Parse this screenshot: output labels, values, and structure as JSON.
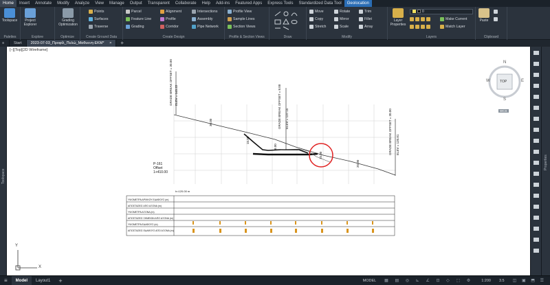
{
  "menu_tabs": [
    "Home",
    "Insert",
    "Annotate",
    "Modify",
    "Analyze",
    "View",
    "Manage",
    "Output",
    "Transparent",
    "Collaborate",
    "Help",
    "Add-ins",
    "Featured Apps",
    "Express Tools",
    "Standardized Data Tool",
    "Geolocation"
  ],
  "ribbon": {
    "toolspace": "Toolspace",
    "project_explorer": "Project Explorer",
    "grading_optimization": "Grading Optimization",
    "palettes": "Palettes",
    "explore": "Explore",
    "optimize": "Optimize",
    "ground_data": {
      "points": "Points",
      "surfaces": "Surfaces",
      "traverse": "Traverse",
      "title": "Create Ground Data"
    },
    "design": {
      "parcel": "Parcel",
      "feature_line": "Feature Line",
      "grading": "Grading",
      "alignment": "Alignment",
      "profile": "Profile",
      "corridor": "Corridor",
      "intersections": "Intersections",
      "assembly": "Assembly",
      "pipe_network": "Pipe Network",
      "title": "Create Design"
    },
    "profile_section": {
      "profile_view": "Profile View",
      "sample_lines": "Sample Lines",
      "section_views": "Section Views",
      "title": "Profile & Section Views"
    },
    "draw_title": "Draw",
    "modify": {
      "move": "Move",
      "copy": "Copy",
      "stretch": "Stretch",
      "rotate": "Rotate",
      "mirror": "Mirror",
      "scale": "Scale",
      "trim": "Trim",
      "fillet": "Fillet",
      "array": "Array",
      "title": "Modify"
    },
    "layers": {
      "layer_properties": "Layer Properties",
      "layer_value": "0",
      "make_current": "Make Current",
      "match_layer": "Match Layer",
      "title": "Layers"
    },
    "clipboard": {
      "paste": "Paste",
      "title": "Clipboard"
    }
  },
  "doc_tabs": {
    "start": "Start",
    "drawing": "2023-07-03_Προφίλ_Πυλώ_Μαθυενη-ΕΚΜ*"
  },
  "viewport_label": "[−][Top][2D Wireframe]",
  "side_labels": {
    "left": "Toolspace",
    "right": "Properties"
  },
  "viewcube": {
    "n": "N",
    "s": "S",
    "w": "W",
    "e": "E",
    "top": "TOP",
    "wcs": "WCS"
  },
  "drawing": {
    "left_label_1": "GRADE BREAK OFFSET = 30.00",
    "left_label_2": "ELEV = 145.22",
    "mid_label_1": "GRADE BREAK OFFSET = 8.00",
    "mid_label_2": "ELEV = 137.15",
    "right_label_1": "GRADE BREAK OFFSET = 30.00",
    "right_label_2": "ELEV = 120.81",
    "slope_1": "30.00",
    "slope_2": "15.00",
    "slope_3": "8.00",
    "slope_4": "10.00",
    "slope_5": "20.00",
    "station_1": "P-161",
    "station_2": "Offset",
    "station_3": "1+410.00",
    "datum": "h=120.00 m",
    "table_rows": [
      "ΥΨΟΜΕΤΡΑ ΑΡΧΙΚΟΥ ΕΔΑΦΟΥΣ (m)",
      "ΑΠΟΣΤΑΣΕΙΣ ΑΠΟ ΑΞΟΝΑ (m)",
      "ΥΨΟΜΕΤΡΑ ΑΞΟΝΑ (m)",
      "ΑΠΟΣΤΑΣΕΙΣ ΣΗΜΕΙΩΝ ΑΠΟ ΑΞΟΝΑ (m)",
      "ΥΨΟΜΕΤΡΑ ΕΔΑΦΟΥΣ (m)",
      "ΑΠΟΣΤΑΣΕΙΣ ΕΔΑΦΟΥΣ ΑΠΟ ΑΞΟΝΑ (m)"
    ]
  },
  "ucs": {
    "y": "Y",
    "x": "X"
  },
  "statusbar": {
    "model": "Model",
    "layout": "Layout1",
    "model_space": "MODEL",
    "scale": "1:200",
    "zoom": "3.5"
  },
  "colors": {
    "accent": "#2a6db5",
    "annotation_circle": "#e02020"
  }
}
